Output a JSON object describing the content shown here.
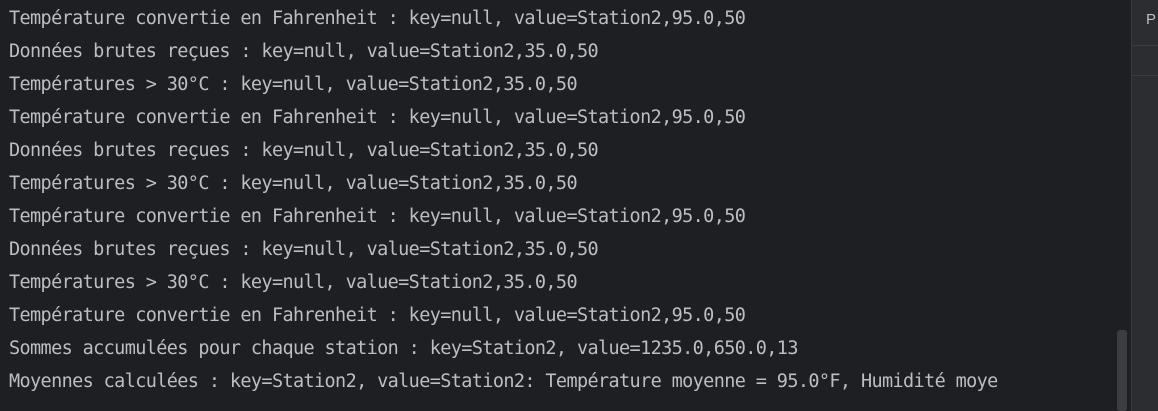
{
  "console": {
    "lines": [
      "Température convertie en Fahrenheit : key=null, value=Station2,95.0,50",
      "Données brutes reçues : key=null, value=Station2,35.0,50",
      "Températures > 30°C : key=null, value=Station2,35.0,50",
      "Température convertie en Fahrenheit : key=null, value=Station2,95.0,50",
      "Données brutes reçues : key=null, value=Station2,35.0,50",
      "Températures > 30°C : key=null, value=Station2,35.0,50",
      "Température convertie en Fahrenheit : key=null, value=Station2,95.0,50",
      "Données brutes reçues : key=null, value=Station2,35.0,50",
      "Températures > 30°C : key=null, value=Station2,35.0,50",
      "Température convertie en Fahrenheit : key=null, value=Station2,95.0,50",
      "Sommes accumulées pour chaque station : key=Station2, value=1235.0,650.0,13",
      "Moyennes calculées : key=Station2, value=Station2: Température moyenne = 95.0°F, Humidité moye"
    ]
  },
  "side_panel": {
    "header_letter": "P"
  }
}
